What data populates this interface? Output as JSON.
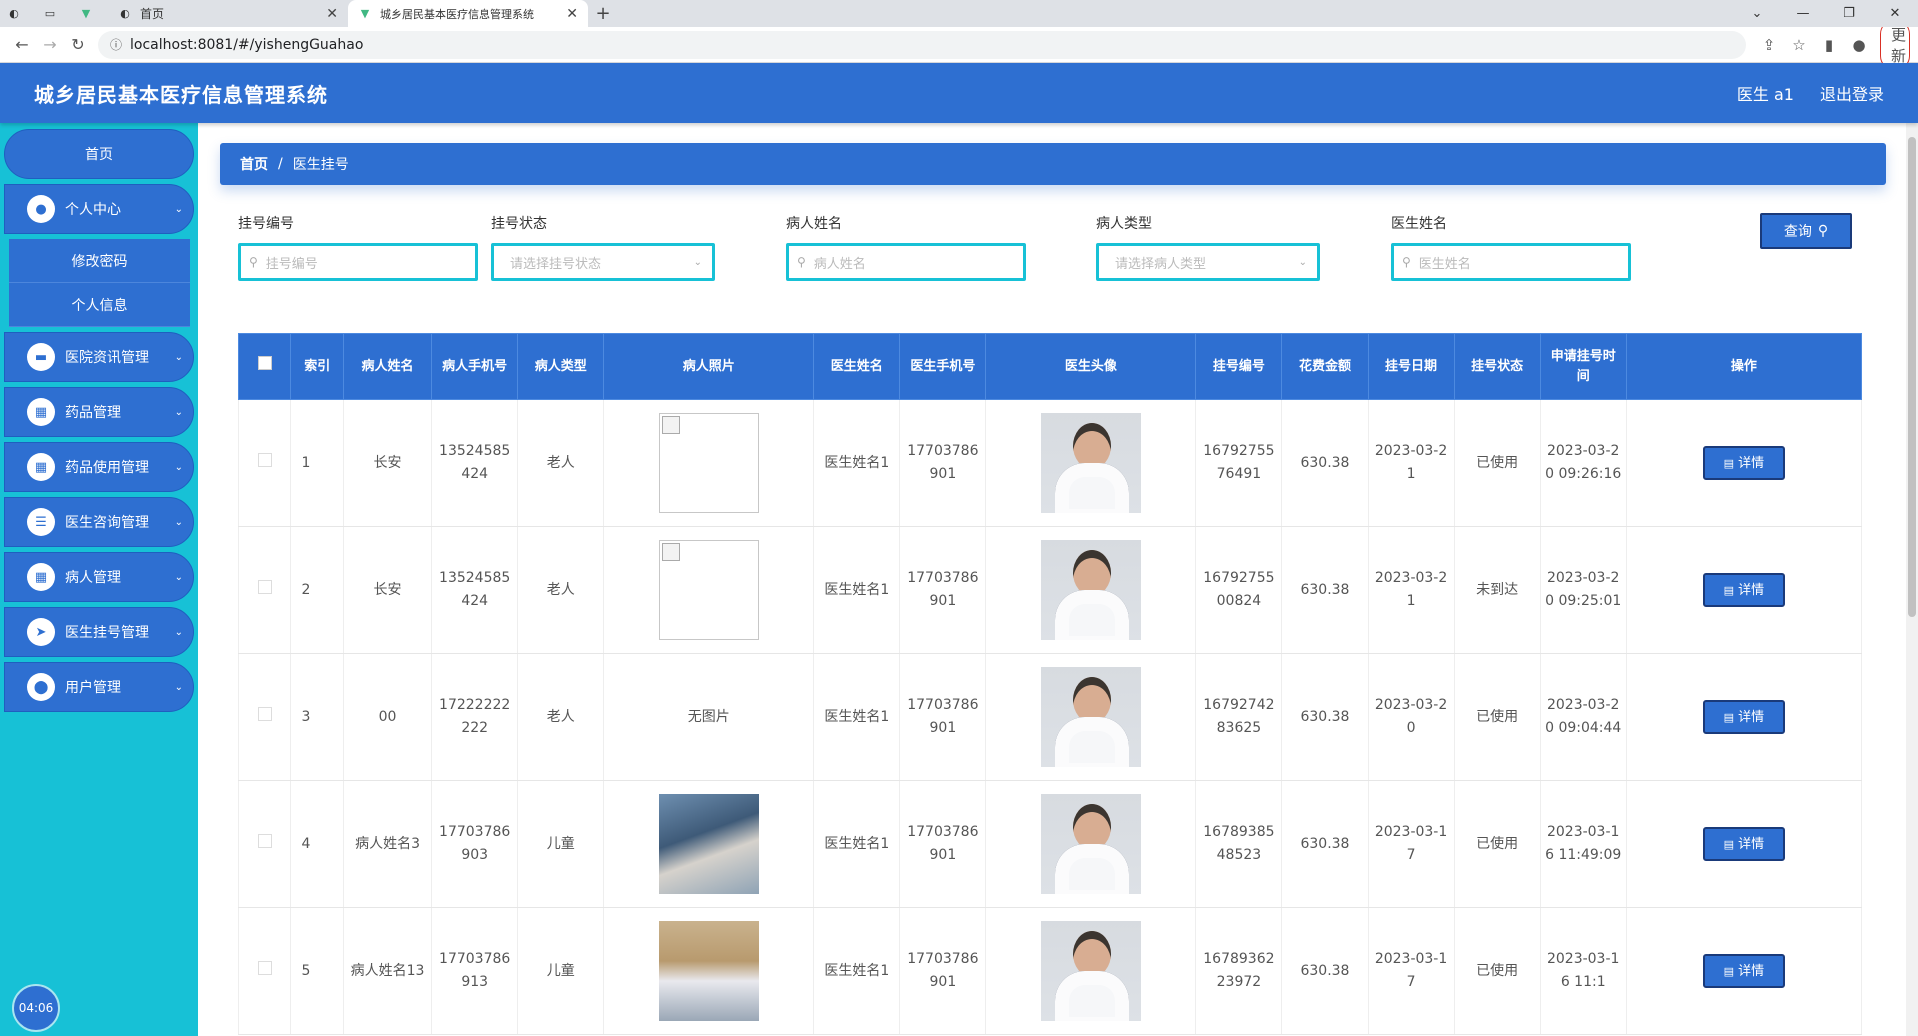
{
  "browser": {
    "tabs": [
      {
        "title": "",
        "icon": "globe-icon"
      },
      {
        "title": "",
        "icon": "blank-page-icon"
      },
      {
        "title": "",
        "icon": "vue-icon"
      },
      {
        "title": "首页",
        "icon": "globe-icon"
      },
      {
        "title": "城乡居民基本医疗信息管理系统",
        "icon": "vue-icon"
      }
    ],
    "url": "localhost:8081/#/yishengGuahao",
    "update_label": "更新"
  },
  "header": {
    "title": "城乡居民基本医疗信息管理系统",
    "user": "医生 a1",
    "logout": "退出登录"
  },
  "sidebar": {
    "home": "首页",
    "items": [
      {
        "label": "个人中心",
        "icon": "user-icon",
        "sub": [
          "修改密码",
          "个人信息"
        ]
      },
      {
        "label": "医院资讯管理",
        "icon": "briefcase-icon"
      },
      {
        "label": "药品管理",
        "icon": "grid-icon"
      },
      {
        "label": "药品使用管理",
        "icon": "grid-icon"
      },
      {
        "label": "医生咨询管理",
        "icon": "list-icon"
      },
      {
        "label": "病人管理",
        "icon": "grid-icon"
      },
      {
        "label": "医生挂号管理",
        "icon": "send-icon"
      },
      {
        "label": "用户管理",
        "icon": "pin-icon"
      }
    ],
    "clock": "04:06"
  },
  "breadcrumb": {
    "home": "首页",
    "current": "医生挂号"
  },
  "search": {
    "fields": [
      {
        "label": "挂号编号",
        "placeholder": "挂号编号"
      },
      {
        "label": "挂号状态",
        "placeholder": "请选择挂号状态"
      },
      {
        "label": "病人姓名",
        "placeholder": "病人姓名"
      },
      {
        "label": "病人类型",
        "placeholder": "请选择病人类型"
      },
      {
        "label": "医生姓名",
        "placeholder": "医生姓名"
      }
    ],
    "query_label": "查询"
  },
  "table": {
    "headers": [
      "",
      "索引",
      "病人姓名",
      "病人手机号",
      "病人类型",
      "病人照片",
      "医生姓名",
      "医生手机号",
      "医生头像",
      "挂号编号",
      "花费金额",
      "挂号日期",
      "挂号状态",
      "申请挂号时间",
      "操作"
    ],
    "detail_label": "详情",
    "no_image": "无图片",
    "rows": [
      {
        "index": "1",
        "patient": "长安",
        "phone": "13524585424",
        "ptype": "老人",
        "photo": "broken",
        "doctor": "医生姓名1",
        "dphone": "17703786901",
        "code": "1679275576491",
        "amount": "630.38",
        "date": "2023-03-21",
        "status": "已使用",
        "apply": "2023-03-20 09:26:16"
      },
      {
        "index": "2",
        "patient": "长安",
        "phone": "13524585424",
        "ptype": "老人",
        "photo": "broken",
        "doctor": "医生姓名1",
        "dphone": "17703786901",
        "code": "1679275500824",
        "amount": "630.38",
        "date": "2023-03-21",
        "status": "未到达",
        "apply": "2023-03-20 09:25:01"
      },
      {
        "index": "3",
        "patient": "00",
        "phone": "17222222222",
        "ptype": "老人",
        "photo": "none",
        "doctor": "医生姓名1",
        "dphone": "17703786901",
        "code": "1679274283625",
        "amount": "630.38",
        "date": "2023-03-20",
        "status": "已使用",
        "apply": "2023-03-20 09:04:44"
      },
      {
        "index": "4",
        "patient": "病人姓名3",
        "phone": "17703786903",
        "ptype": "儿童",
        "photo": "photo-a",
        "doctor": "医生姓名1",
        "dphone": "17703786901",
        "code": "1678938548523",
        "amount": "630.38",
        "date": "2023-03-17",
        "status": "已使用",
        "apply": "2023-03-16 11:49:09"
      },
      {
        "index": "5",
        "patient": "病人姓名13",
        "phone": "17703786913",
        "ptype": "儿童",
        "photo": "photo-b",
        "doctor": "医生姓名1",
        "dphone": "17703786901",
        "code": "1678936223972",
        "amount": "630.38",
        "date": "2023-03-17",
        "status": "已使用",
        "apply": "2023-03-16 11:1"
      }
    ]
  }
}
